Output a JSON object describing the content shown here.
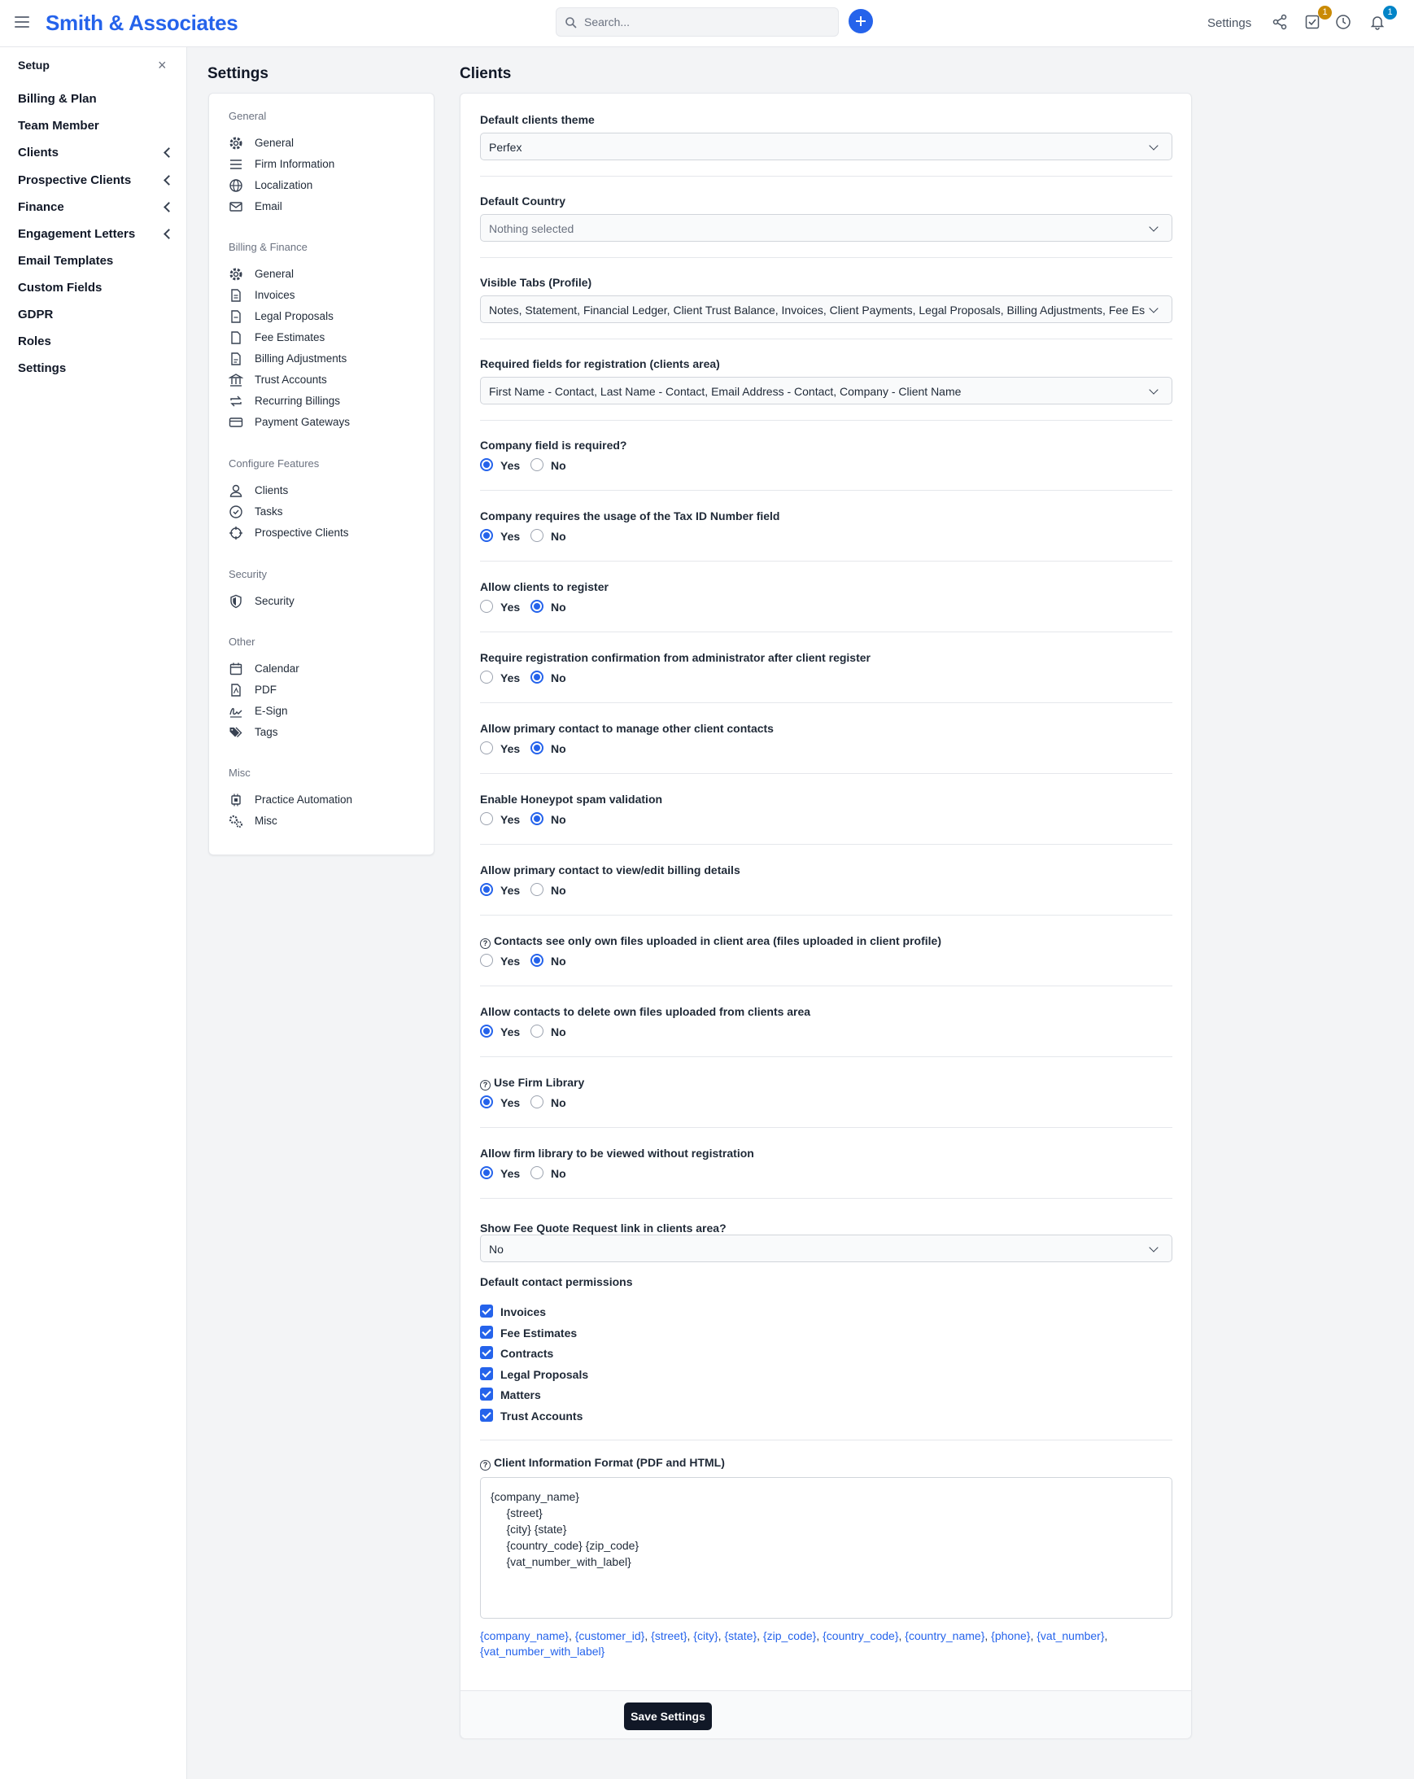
{
  "header": {
    "brand": "Smith & Associates",
    "search_placeholder": "Search...",
    "settings_label": "Settings",
    "tasks_badge": "1",
    "notifications_badge": "1"
  },
  "leftnav": {
    "title": "Setup",
    "close": "×",
    "items": [
      {
        "label": "Billing & Plan"
      },
      {
        "label": "Team Member"
      },
      {
        "label": "Clients"
      },
      {
        "label": "Prospective Clients"
      },
      {
        "label": "Finance"
      },
      {
        "label": "Engagement Letters"
      },
      {
        "label": "Email Templates"
      },
      {
        "label": "Custom Fields"
      },
      {
        "label": "GDPR"
      },
      {
        "label": "Roles"
      },
      {
        "label": "Settings"
      }
    ]
  },
  "settings_menu": {
    "title": "Settings",
    "groups": [
      {
        "title": "General",
        "items": [
          "General",
          "Firm Information",
          "Localization",
          "Email"
        ]
      },
      {
        "title": "Billing & Finance",
        "items": [
          "General",
          "Invoices",
          "Legal Proposals",
          "Fee Estimates",
          "Billing Adjustments",
          "Trust Accounts",
          "Recurring Billings",
          "Payment Gateways"
        ]
      },
      {
        "title": "Configure Features",
        "items": [
          "Clients",
          "Tasks",
          "Prospective Clients"
        ]
      },
      {
        "title": "Security",
        "items": [
          "Security"
        ]
      },
      {
        "title": "Other",
        "items": [
          "Calendar",
          "PDF",
          "E-Sign",
          "Tags"
        ]
      },
      {
        "title": "Misc",
        "items": [
          "Practice Automation",
          "Misc"
        ]
      }
    ]
  },
  "clients": {
    "title": "Clients",
    "theme_label": "Default clients theme",
    "theme_value": "Perfex",
    "country_label": "Default Country",
    "country_value": "Nothing selected",
    "tabs_label": "Visible Tabs (Profile)",
    "tabs_value": "Notes, Statement, Financial Ledger, Client Trust Balance, Invoices, Client Payments, Legal Proposals, Billing Adjustments, Fee Es",
    "required_label": "Required fields for registration (clients area)",
    "required_value": "First Name - Contact, Last Name - Contact, Email Address - Contact, Company - Client Name",
    "yes": "Yes",
    "no": "No",
    "radios": [
      {
        "label": "Company field is required?",
        "value": "Yes",
        "help": false
      },
      {
        "label": "Company requires the usage of the Tax ID Number field",
        "value": "Yes",
        "help": false
      },
      {
        "label": "Allow clients to register",
        "value": "No",
        "help": false
      },
      {
        "label": "Require registration confirmation from administrator after client register",
        "value": "No",
        "help": false
      },
      {
        "label": "Allow primary contact to manage other client contacts",
        "value": "No",
        "help": false
      },
      {
        "label": "Enable Honeypot spam validation",
        "value": "No",
        "help": false
      },
      {
        "label": "Allow primary contact to view/edit billing details",
        "value": "Yes",
        "help": false
      },
      {
        "label": "Contacts see only own files uploaded in client area (files uploaded in client profile)",
        "value": "No",
        "help": true
      },
      {
        "label": "Allow contacts to delete own files uploaded from clients area",
        "value": "Yes",
        "help": false
      },
      {
        "label": "Use Firm Library",
        "value": "Yes",
        "help": true
      },
      {
        "label": "Allow firm library to be viewed without registration",
        "value": "Yes",
        "help": false
      }
    ],
    "fee_quote_label": "Show Fee Quote Request link in clients area?",
    "fee_quote_value": "No",
    "permissions_label": "Default contact permissions",
    "permissions": [
      "Invoices",
      "Fee Estimates",
      "Contracts",
      "Legal Proposals",
      "Matters",
      "Trust Accounts"
    ],
    "format_label": "Client Information Format (PDF and HTML)",
    "format_lines": [
      "{company_name}",
      "     {street}",
      "     {city} {state}",
      "     {country_code} {zip_code}",
      "     {vat_number_with_label}"
    ],
    "merge_fields": [
      "{company_name}",
      "{customer_id}",
      "{street}",
      "{city}",
      "{state}",
      "{zip_code}",
      "{country_code}",
      "{country_name}",
      "{phone}",
      "{vat_number}",
      "{vat_number_with_label}"
    ],
    "save_label": "Save Settings"
  },
  "colors": {
    "accent": "#2563eb",
    "dark": "#111827",
    "badge_orange": "#ca8a04",
    "badge_blue": "#0284c7"
  }
}
